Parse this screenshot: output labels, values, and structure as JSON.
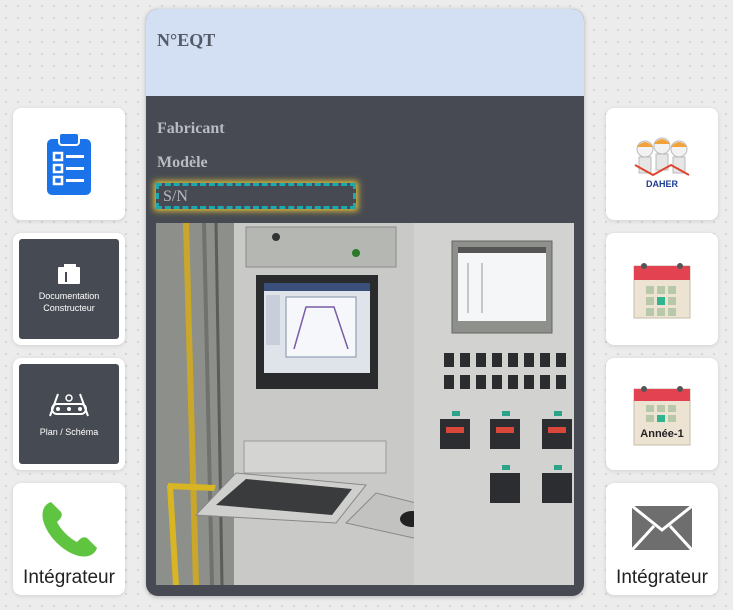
{
  "card": {
    "title": "N°EQT",
    "fields": {
      "fabricant": "Fabricant",
      "modele": "Modèle",
      "sn": "S/N"
    }
  },
  "left_tiles": [
    {
      "icon": "clipboard-icon"
    },
    {
      "icon": "folder-icon",
      "label": "Documentation Constructeur"
    },
    {
      "icon": "conveyor-icon",
      "label": "Plan / Schéma"
    },
    {
      "icon": "phone-icon",
      "label": "Intégrateur"
    }
  ],
  "right_tiles": [
    {
      "icon": "team-logo",
      "logo_text": "DAHER"
    },
    {
      "icon": "calendar-icon"
    },
    {
      "icon": "calendar-icon",
      "label": "Année-1"
    },
    {
      "icon": "mail-icon",
      "label": "Intégrateur"
    }
  ],
  "colors": {
    "header_bg": "#d3e0f4",
    "card_bg": "#474a52",
    "accent_blue": "#1a73e8",
    "phone_green": "#5fc43f",
    "calendar_red": "#e34250",
    "highlight_dash": "#1aa9b0"
  }
}
